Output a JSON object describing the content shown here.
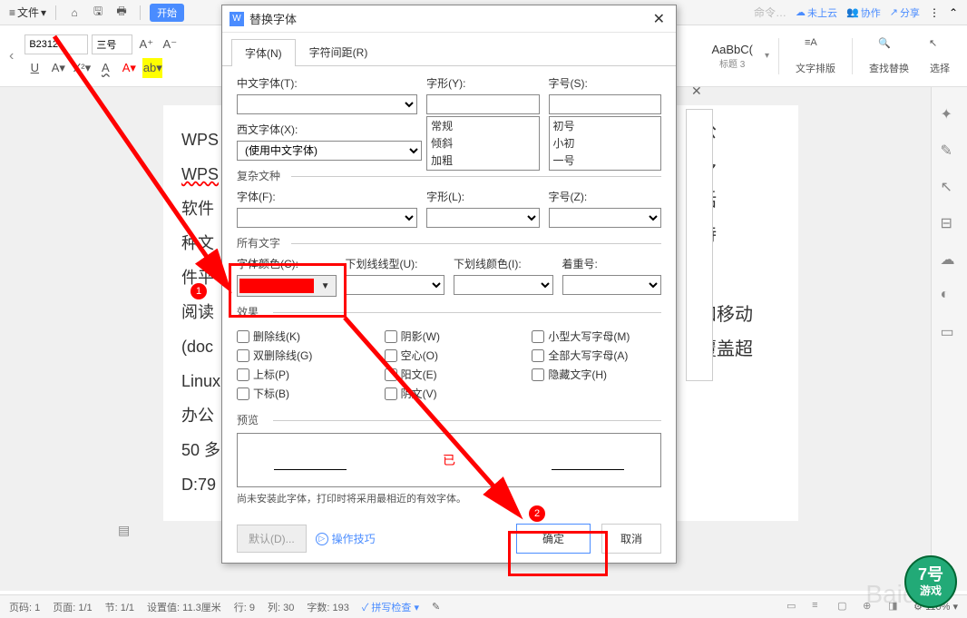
{
  "toolbar": {
    "file": "文件",
    "start": "开始",
    "cloud": "未上云",
    "collab": "协作",
    "share": "分享",
    "cmd": "命令…"
  },
  "ribbon": {
    "font": "B2312",
    "size": "三号",
    "style_text": "AaBbC(",
    "style_label": "标题 3",
    "layout": "文字排版",
    "findreplace": "查找替换",
    "select": "选择"
  },
  "doc": {
    "line1": "WPS",
    "line2": "WPS",
    "line3": "软件",
    "line4": "种文",
    "line5": "件平",
    "line6": "阅读",
    "line7": "(doc",
    "line8": "Linux",
    "line9": "办公",
    "line10": "50 多",
    "line11": "D:79",
    "right1": "公",
    "right2": "多",
    "right3": "括",
    "right4": "持",
    "right5": "和移动",
    "right6": "覆盖超"
  },
  "dialog": {
    "title": "替换字体",
    "tab1": "字体(N)",
    "tab2": "字符间距(R)",
    "chinese_font": "中文字体(T):",
    "western_font": "西文字体(X):",
    "western_value": "(使用中文字体)",
    "font_style": "字形(Y):",
    "font_size": "字号(S):",
    "style_opt1": "常规",
    "style_opt2": "倾斜",
    "style_opt3": "加粗",
    "size_opt1": "初号",
    "size_opt2": "小初",
    "size_opt3": "一号",
    "complex": "复杂文种",
    "font_f": "字体(F):",
    "style_l": "字形(L):",
    "size_z": "字号(Z):",
    "all_text": "所有文字",
    "font_color": "字体颜色(C):",
    "underline_style": "下划线线型(U):",
    "underline_color": "下划线颜色(I):",
    "emphasis": "着重号:",
    "effects": "效果",
    "eff_strike": "删除线(K)",
    "eff_dstrike": "双删除线(G)",
    "eff_super": "上标(P)",
    "eff_sub": "下标(B)",
    "eff_shadow": "阴影(W)",
    "eff_hollow": "空心(O)",
    "eff_emboss": "阳文(E)",
    "eff_engrave": "阴文(V)",
    "eff_smallcaps": "小型大写字母(M)",
    "eff_allcaps": "全部大写字母(A)",
    "eff_hidden": "隐藏文字(H)",
    "preview": "预览",
    "preview_text": "已",
    "preview_note": "尚未安装此字体，打印时将采用最相近的有效字体。",
    "default": "默认(D)...",
    "tips": "操作技巧",
    "ok": "确定",
    "cancel": "取消"
  },
  "status": {
    "page": "页码: 1",
    "pages": "页面: 1/1",
    "section": "节: 1/1",
    "position": "设置值: 11.3厘米",
    "row": "行: 9",
    "col": "列: 30",
    "words": "字数: 193",
    "spell": "拼写检查",
    "zoom": "110%"
  },
  "markers": {
    "m1": "1",
    "m2": "2"
  }
}
